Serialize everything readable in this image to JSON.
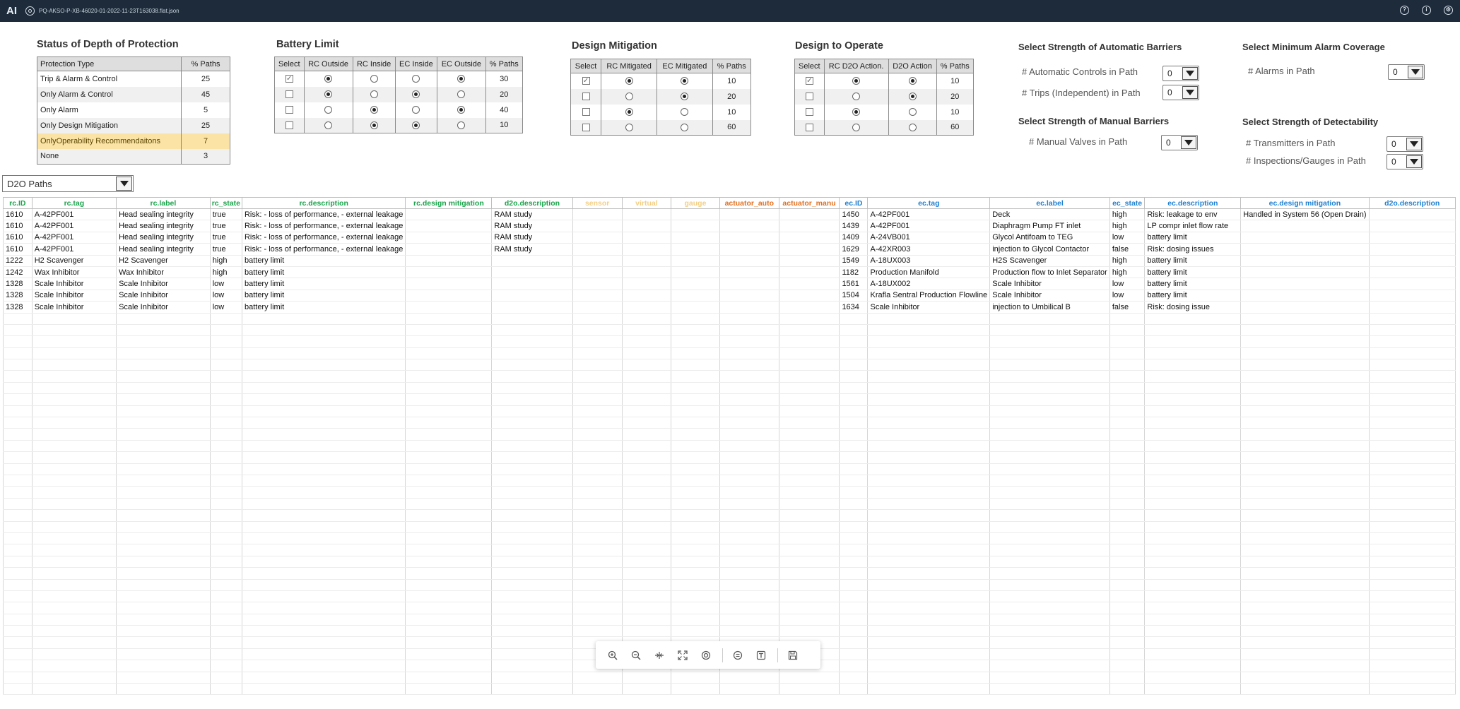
{
  "app": {
    "logo": "AI",
    "filename": "PQ-AKSO-P-XB-46020-01-2022-11-23T163038.flat.json"
  },
  "header_icons": [
    "help-icon",
    "info-icon",
    "settings-icon"
  ],
  "depth_protection": {
    "title": "Status of Depth of Protection",
    "headers": [
      "Protection Type",
      "% Paths"
    ],
    "rows": [
      [
        "Trip & Alarm & Control",
        "25"
      ],
      [
        "Only Alarm & Control",
        "45"
      ],
      [
        "Only Alarm",
        "5"
      ],
      [
        "Only Design Mitigation",
        "25"
      ],
      [
        "OnlyOperability Recommendaitons",
        "7"
      ],
      [
        "None",
        "3"
      ]
    ],
    "highlight_row": 4,
    "highlight_color": "#fbe3a6"
  },
  "battery_limit": {
    "title": "Battery Limit",
    "headers": [
      "Select",
      "RC Outside",
      "RC Inside",
      "EC Inside",
      "EC Outside",
      "% Paths"
    ],
    "rows": [
      {
        "checked": true,
        "radios": [
          true,
          false,
          false,
          true
        ],
        "pct": "30"
      },
      {
        "checked": false,
        "radios": [
          true,
          false,
          true,
          false
        ],
        "pct": "20"
      },
      {
        "checked": false,
        "radios": [
          false,
          true,
          false,
          true
        ],
        "pct": "40"
      },
      {
        "checked": false,
        "radios": [
          false,
          true,
          true,
          false
        ],
        "pct": "10"
      }
    ]
  },
  "design_mitigation": {
    "title": "Design Mitigation",
    "headers": [
      "Select",
      "RC Mitigated",
      "EC Mitigated",
      "% Paths"
    ],
    "rows": [
      {
        "checked": true,
        "radios": [
          true,
          true
        ],
        "pct": "10"
      },
      {
        "checked": false,
        "radios": [
          false,
          true
        ],
        "pct": "20"
      },
      {
        "checked": false,
        "radios": [
          true,
          false
        ],
        "pct": "10"
      },
      {
        "checked": false,
        "radios": [
          false,
          false
        ],
        "pct": "60"
      }
    ]
  },
  "design_operate": {
    "title": "Design to Operate",
    "headers": [
      "Select",
      "RC D2O Action.",
      "D2O Action",
      "% Paths"
    ],
    "rows": [
      {
        "checked": true,
        "radios": [
          true,
          true
        ],
        "pct": "10"
      },
      {
        "checked": false,
        "radios": [
          false,
          true
        ],
        "pct": "20"
      },
      {
        "checked": false,
        "radios": [
          true,
          false
        ],
        "pct": "10"
      },
      {
        "checked": false,
        "radios": [
          false,
          false
        ],
        "pct": "60"
      }
    ]
  },
  "auto_barriers": {
    "title": "Select Strength of Automatic Barriers",
    "controls_label": "# Automatic Controls in Path",
    "controls_value": "0",
    "trips_label": "# Trips (Independent) in Path",
    "trips_value": "0"
  },
  "manual_barriers": {
    "title": "Select Strength of Manual Barriers",
    "valves_label": "# Manual Valves in Path",
    "valves_value": "0"
  },
  "alarm_coverage": {
    "title": "Select Minimum Alarm Coverage",
    "alarms_label": "# Alarms in Path",
    "alarms_value": "0"
  },
  "detectability": {
    "title": "Select Strength of Detectability",
    "transmitters_label": "# Transmitters in Path",
    "transmitters_value": "0",
    "inspections_label": "# Inspections/Gauges in Path",
    "inspections_value": "0"
  },
  "paths_select": {
    "value": "D2O Paths"
  },
  "grid": {
    "columns": [
      {
        "label": "rc.ID",
        "color": "#1aa34a"
      },
      {
        "label": "rc.tag",
        "color": "#1aa34a"
      },
      {
        "label": "rc.label",
        "color": "#1aa34a"
      },
      {
        "label": "rc_state",
        "color": "#1aa34a"
      },
      {
        "label": "rc.description",
        "color": "#1aa34a"
      },
      {
        "label": "rc.design mitigation",
        "color": "#1aa34a"
      },
      {
        "label": "d2o.description",
        "color": "#1aa34a"
      },
      {
        "label": "sensor",
        "color": "#f3cf86"
      },
      {
        "label": "virtual",
        "color": "#f3cf86"
      },
      {
        "label": "gauge",
        "color": "#f3cf86"
      },
      {
        "label": "actuator_auto",
        "color": "#e07020"
      },
      {
        "label": "actuator_manu",
        "color": "#e07020"
      },
      {
        "label": "ec.ID",
        "color": "#1f7fd0"
      },
      {
        "label": "ec.tag",
        "color": "#1f7fd0"
      },
      {
        "label": "ec.label",
        "color": "#1f7fd0"
      },
      {
        "label": "ec_state",
        "color": "#1f7fd0"
      },
      {
        "label": "ec.description",
        "color": "#1f7fd0"
      },
      {
        "label": "ec.design mitigation",
        "color": "#1f7fd0"
      },
      {
        "label": "d2o.description",
        "color": "#1f7fd0"
      }
    ],
    "rows": [
      [
        "1610",
        "A-42PF001",
        "Head sealing integrity",
        "true",
        "Risk: - loss of performance, - external leakage",
        "",
        "RAM study",
        "",
        "",
        "",
        "",
        "",
        "1450",
        "A-42PF001",
        "Deck",
        "high",
        "Risk: leakage to env",
        "Handled in System 56 (Open Drain)",
        ""
      ],
      [
        "1610",
        "A-42PF001",
        "Head sealing integrity",
        "true",
        "Risk: - loss of performance, - external leakage",
        "",
        "RAM study",
        "",
        "",
        "",
        "",
        "",
        "1439",
        "A-42PF001",
        "Diaphragm Pump FT inlet",
        "high",
        "LP compr inlet flow rate",
        "",
        ""
      ],
      [
        "1610",
        "A-42PF001",
        "Head sealing integrity",
        "true",
        "Risk: - loss of performance, - external leakage",
        "",
        "RAM study",
        "",
        "",
        "",
        "",
        "",
        "1409",
        "A-24VB001",
        "Glycol Antifoam to TEG",
        "low",
        "battery limit",
        "",
        ""
      ],
      [
        "1610",
        "A-42PF001",
        "Head sealing integrity",
        "true",
        "Risk: - loss of performance, - external leakage",
        "",
        "RAM study",
        "",
        "",
        "",
        "",
        "",
        "1629",
        "A-42XR003",
        "injection to Glycol Contactor",
        "false",
        "Risk: dosing issues",
        "",
        ""
      ],
      [
        "1222",
        "H2 Scavenger",
        "H2 Scavenger",
        "high",
        "battery limit",
        "",
        "",
        "",
        "",
        "",
        "",
        "",
        "1549",
        "A-18UX003",
        "H2S Scavenger",
        "high",
        "battery limit",
        "",
        ""
      ],
      [
        "1242",
        "Wax Inhibitor",
        "Wax Inhibitor",
        "high",
        "battery limit",
        "",
        "",
        "",
        "",
        "",
        "",
        "",
        "1182",
        "Production Manifold",
        "Production flow to Inlet Separator",
        "high",
        "battery limit",
        "",
        ""
      ],
      [
        "1328",
        "Scale Inhibitor",
        "Scale Inhibitor",
        "low",
        "battery limit",
        "",
        "",
        "",
        "",
        "",
        "",
        "",
        "1561",
        "A-18UX002",
        "Scale Inhibitor",
        "low",
        "battery limit",
        "",
        ""
      ],
      [
        "1328",
        "Scale Inhibitor",
        "Scale Inhibitor",
        "low",
        "battery limit",
        "",
        "",
        "",
        "",
        "",
        "",
        "",
        "1504",
        "Krafla Sentral Production Flowline",
        "Scale Inhibitor",
        "low",
        "battery limit",
        "",
        ""
      ],
      [
        "1328",
        "Scale Inhibitor",
        "Scale Inhibitor",
        "low",
        "battery limit",
        "",
        "",
        "",
        "",
        "",
        "",
        "",
        "1634",
        "Scale Inhibitor",
        "injection to Umbilical B",
        "false",
        "Risk: dosing issue",
        "",
        ""
      ]
    ],
    "empty_rows": 33
  },
  "toolbar": {
    "buttons": [
      "zoom-in-icon",
      "zoom-out-icon",
      "fit-width-icon",
      "fullscreen-icon",
      "target-icon",
      "list-icon",
      "text-icon",
      "save-icon"
    ]
  }
}
